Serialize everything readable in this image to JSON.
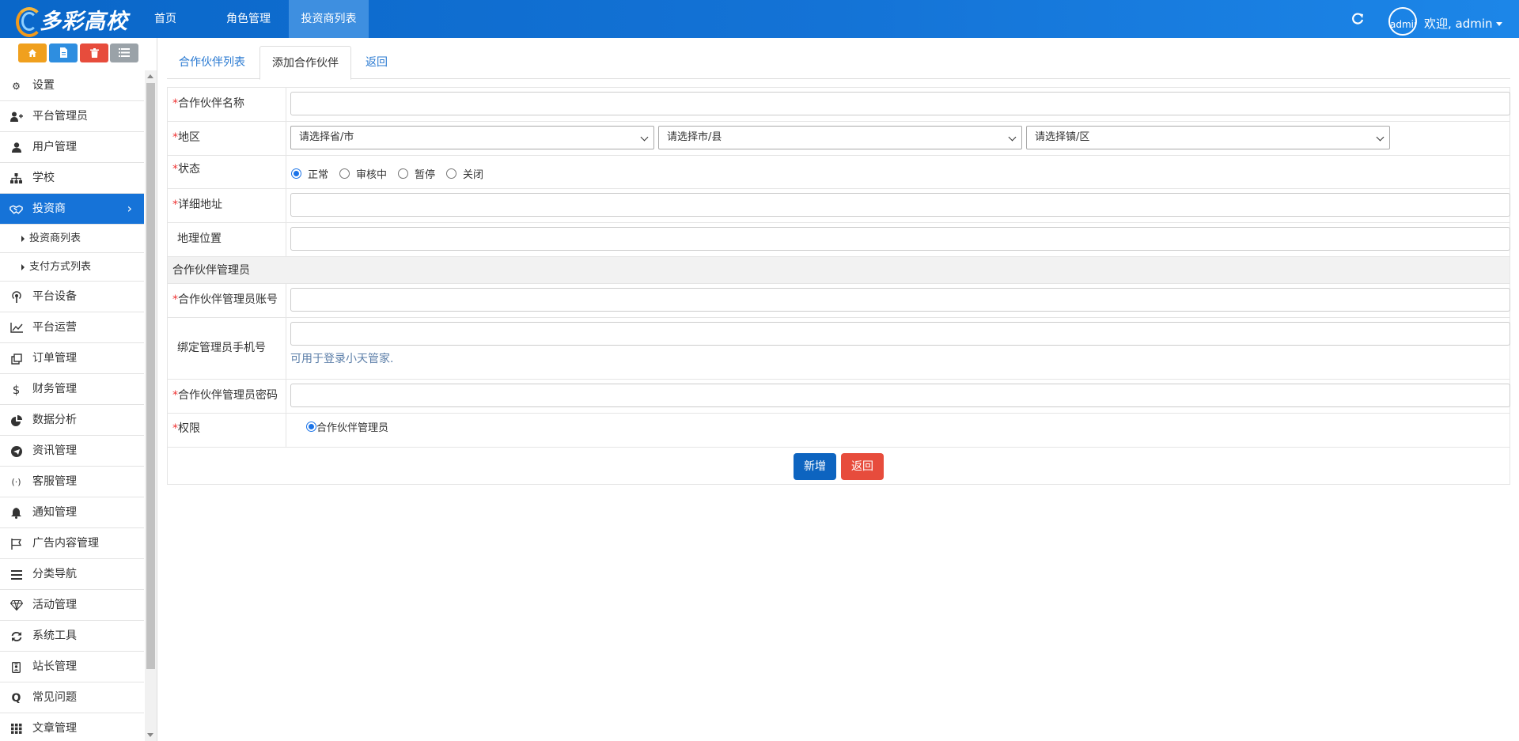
{
  "topbar": {
    "logo_text": "多彩高校",
    "nav": [
      "首页",
      "角色管理",
      "投资商列表"
    ],
    "avatar_alt": "admin",
    "welcome": "欢迎, admin"
  },
  "sidebar": {
    "menu": {
      "settings": "设置",
      "platform_admin": "平台管理员",
      "user_mgmt": "用户管理",
      "school": "学校",
      "investor": "投资商",
      "investor_list": "投资商列表",
      "payment_list": "支付方式列表",
      "device": "平台设备",
      "operation": "平台运营",
      "order": "订单管理",
      "finance": "财务管理",
      "analysis": "数据分析",
      "news": "资讯管理",
      "service": "客服管理",
      "notice": "通知管理",
      "ads": "广告内容管理",
      "category": "分类导航",
      "activity": "活动管理",
      "tools": "系统工具",
      "station": "站长管理",
      "faq": "常见问题",
      "article": "文章管理"
    }
  },
  "tabs": {
    "list": "合作伙伴列表",
    "add": "添加合作伙伴",
    "back": "返回"
  },
  "form": {
    "name_label": "合作伙伴名称",
    "region_label": "地区",
    "province_placeholder": "请选择省/市",
    "city_placeholder": "请选择市/县",
    "district_placeholder": "请选择镇/区",
    "status_label": "状态",
    "status_options": [
      "正常",
      "审核中",
      "暂停",
      "关闭"
    ],
    "status_selected": "正常",
    "address_label": "详细地址",
    "location_label": "地理位置",
    "admin_section": "合作伙伴管理员",
    "account_label": "合作伙伴管理员账号",
    "phone_label": "绑定管理员手机号",
    "phone_hint": "可用于登录小天管家.",
    "password_label": "合作伙伴管理员密码",
    "permission_label": "权限",
    "permission_option": "合作伙伴管理员",
    "required_mark": "*"
  },
  "buttons": {
    "add": "新增",
    "back": "返回"
  },
  "colors": {
    "topbar": "#1473d6",
    "active_menu": "#1673d8",
    "primary_button": "#0d64c0",
    "danger_button": "#e74c3c",
    "required": "#ee3333"
  }
}
